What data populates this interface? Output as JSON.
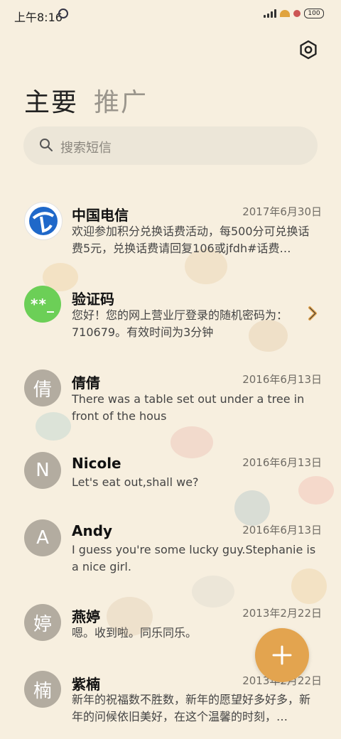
{
  "status_bar": {
    "time": "上午8:16",
    "battery": "100"
  },
  "tabs": [
    {
      "label": "主要",
      "active": true
    },
    {
      "label": "推广",
      "active": false
    }
  ],
  "search": {
    "placeholder": "搜索短信"
  },
  "conversations": [
    {
      "name": "中国电信",
      "date": "2017年6月30日",
      "preview": "欢迎参加积分兑换话费活动，每500分可兑换话费5元，兑换话费请回复106或jfdh#话费…",
      "avatar": "china-telecom-logo"
    },
    {
      "name": "验证码",
      "date": "",
      "preview": "您好！您的网上营业厅登录的随机密码为：710679。有效时间为3分钟",
      "avatar_text": "**_"
    },
    {
      "name": "倩倩",
      "date": "2016年6月13日",
      "preview": "There was a table set out under a tree in front of the hous",
      "avatar_text": "倩"
    },
    {
      "name": "Nicole",
      "date": "2016年6月13日",
      "preview": "Let's eat out,shall we?",
      "avatar_text": "N"
    },
    {
      "name": "Andy",
      "date": "2016年6月13日",
      "preview": "I guess you're some lucky guy.Stephanie is a nice girl.",
      "avatar_text": "A"
    },
    {
      "name": "燕婷",
      "date": "2013年2月22日",
      "preview": "嗯。收到啦。同乐同乐。",
      "avatar_text": "婷"
    },
    {
      "name": "紫楠",
      "date": "2013年2月22日",
      "preview": "新年的祝福数不胜数，新年的愿望好多好多，新年的问候依旧美好，在这个温馨的时刻，…",
      "avatar_text": "楠"
    }
  ],
  "colors": {
    "background": "#f7efdf",
    "fab": "#e3a44f",
    "verification_avatar": "#6ccf57",
    "avatar_gray": "#b3aca0"
  },
  "icons": {
    "settings": "settings-icon",
    "search": "search-icon",
    "compose": "plus-icon",
    "expand": "chevron-right-icon"
  }
}
